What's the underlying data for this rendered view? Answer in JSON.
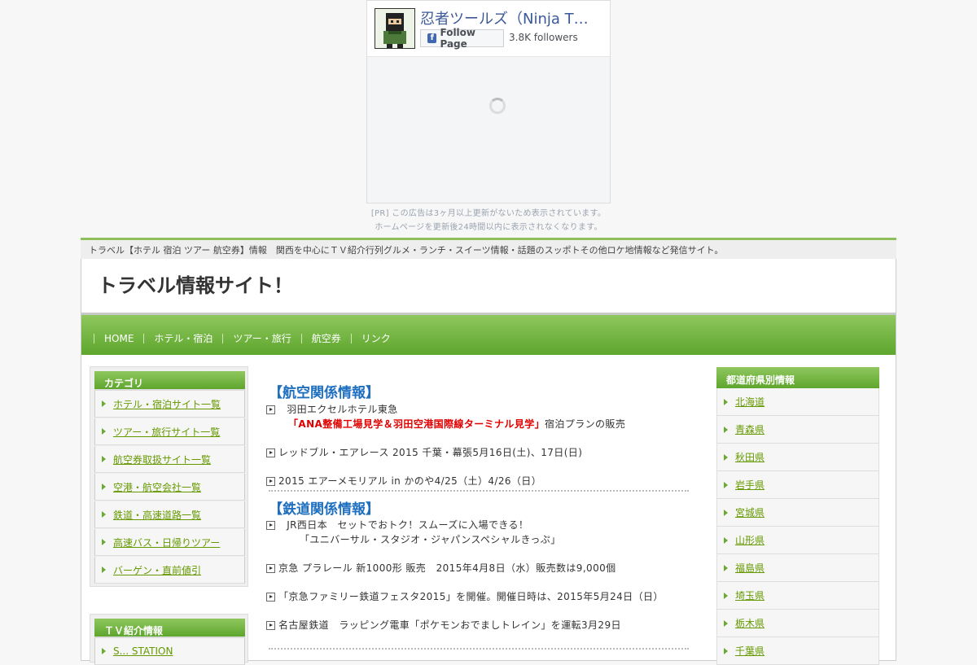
{
  "fb": {
    "title": "忍者ツールズ（Ninja T…",
    "follow_label": "Follow Page",
    "followers": "3.8K followers"
  },
  "pr": {
    "line1": "[PR] この広告は3ヶ月以上更新がないため表示されています。",
    "line2": "ホームページを更新後24時間以内に表示されなくなります。"
  },
  "header": {
    "tagline": "トラベル【ホテル 宿泊 ツアー 航空券】情報　関西を中心にＴＶ紹介行列グルメ・ランチ・スイーツ情報・話題のスッポトその他ロケ地情報など発信サイト。",
    "site_title": "トラベル情報サイト！"
  },
  "nav": {
    "items": [
      "HOME",
      "ホテル・宿泊",
      "ツアー・旅行",
      "航空券",
      "リンク"
    ]
  },
  "left": {
    "category_title": "カテゴリ",
    "categories": [
      "ホテル・宿泊サイト一覧",
      "ツアー・旅行サイト一覧",
      "航空券取扱サイト一覧",
      "空港・航空会社一覧",
      "鉄道・高速道路一覧",
      "高速バス・日帰りツアー",
      "バーゲン・直前値引"
    ],
    "tv_title": "ＴＶ紹介情報",
    "tv_first": "S... STATION"
  },
  "main": {
    "air_title": "【航空関係情報】",
    "air1_line1": "羽田エクセルホテル東急",
    "air1_red": "「ANA整備工場見学＆羽田空港国際線ターミナル見学」",
    "air1_tail": "宿泊プランの販売",
    "air2": "レッドブル・エアレース 2015 千葉・幕張5月16日(土)、17日(日)",
    "air3": "2015 エアーメモリアル in かのや4/25（土）4/26（日）",
    "rail_title": "【鉄道関係情報】",
    "rail1_line1": "JR西日本　セットでおトク！スムーズに入場できる！",
    "rail1_line2": "「ユニバーサル・スタジオ・ジャパンスペシャルきっぷ」",
    "rail2": "京急 プラレール 新1000形 販売　2015年4月8日（水）販売数は9,000個",
    "rail3": "「京急ファミリー鉄道フェスタ2015」を開催。開催日時は、2015年5月24日（日）",
    "rail4": "名古屋鉄道　ラッピング電車「ポケモンおでましトレイン」を運転3月29日"
  },
  "right": {
    "title": "都道府県別情報",
    "prefs": [
      "北海道",
      "青森県",
      "秋田県",
      "岩手県",
      "宮城県",
      "山形県",
      "福島県",
      "埼玉県",
      "栃木県",
      "千葉県"
    ]
  },
  "colors": {
    "accent_green": "#6aaa30",
    "link_green": "#669900",
    "section_blue": "#1f6fc0",
    "alert_red": "#e00000"
  }
}
